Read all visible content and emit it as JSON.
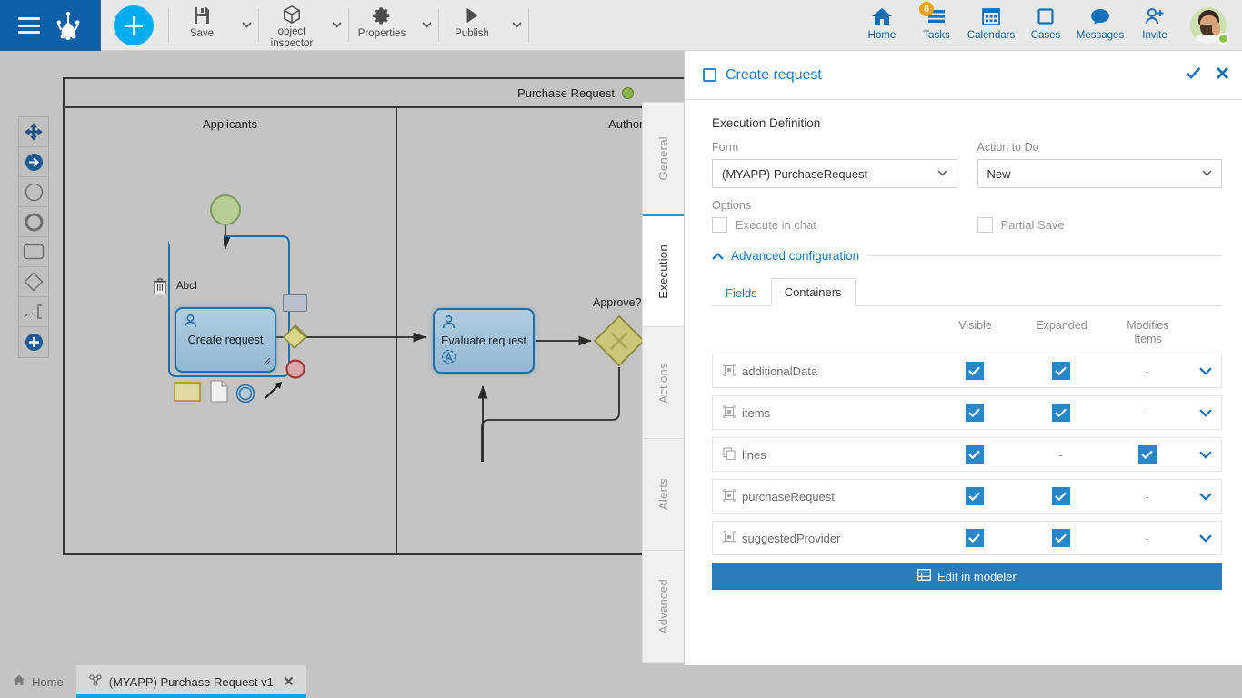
{
  "brand": {
    "logo_icon": "bizagi-frog-logo",
    "menu_icon": "hamburger-menu-icon"
  },
  "toolbar": {
    "new_icon": "plus-icon",
    "items": [
      {
        "label": "Save",
        "icon": "save-floppy-icon",
        "has_caret": true
      },
      {
        "label": "object inspector",
        "icon": "cube-icon",
        "has_caret": true
      },
      {
        "label": "Properties",
        "icon": "gear-icon",
        "has_caret": true
      },
      {
        "label": "Publish",
        "icon": "play-triangle-icon",
        "has_caret": true
      }
    ]
  },
  "topnav": [
    {
      "label": "Home",
      "icon": "home-icon",
      "badge": ""
    },
    {
      "label": "Tasks",
      "icon": "tasks-icon",
      "badge": "8"
    },
    {
      "label": "Calendars",
      "icon": "calendar-icon",
      "badge": ""
    },
    {
      "label": "Cases",
      "icon": "cases-square-icon",
      "badge": ""
    },
    {
      "label": "Messages",
      "icon": "chat-bubble-icon",
      "badge": ""
    },
    {
      "label": "Invite",
      "icon": "invite-person-plus-icon",
      "badge": ""
    }
  ],
  "avatar": {
    "name": "avatar",
    "status": "online"
  },
  "palette": [
    {
      "icon": "move-cross-icon",
      "name": "pan-tool"
    },
    {
      "icon": "sequence-flow-arrow-icon",
      "name": "sequence-flow-tool"
    },
    {
      "icon": "start-event-circle-icon",
      "name": "start-event-tool"
    },
    {
      "icon": "end-event-circle-icon",
      "name": "end-event-tool"
    },
    {
      "icon": "task-rounded-rect-icon",
      "name": "task-tool"
    },
    {
      "icon": "gateway-diamond-icon",
      "name": "gateway-tool"
    },
    {
      "icon": "artifact-group-icon",
      "name": "artifact-tool"
    },
    {
      "icon": "add-circle-icon",
      "name": "add-element-tool"
    }
  ],
  "diagram": {
    "pool_label": "Purchase Request",
    "lanes": [
      {
        "label": "Applicants"
      },
      {
        "label": "Authorizers"
      }
    ],
    "nodes": [
      {
        "id": "start",
        "type": "start-event",
        "label": ""
      },
      {
        "id": "create",
        "type": "user-task",
        "label": "Create request"
      },
      {
        "id": "evaluate",
        "type": "user-task",
        "label": "Evaluate request"
      },
      {
        "id": "approve",
        "type": "exclusive-gateway",
        "label": "Approve?"
      }
    ],
    "selection_toolbar": {
      "text_label": "Abc",
      "tools": [
        {
          "icon": "trash-icon",
          "name": "delete-element"
        },
        {
          "icon": "text-abc-icon",
          "name": "rename-element"
        },
        {
          "icon": "task-shape-icon",
          "name": "change-to-task"
        },
        {
          "icon": "gateway-shape-icon",
          "name": "change-to-gateway"
        },
        {
          "icon": "end-event-shape-icon",
          "name": "change-to-end-event"
        },
        {
          "icon": "note-icon",
          "name": "add-annotation"
        },
        {
          "icon": "document-icon",
          "name": "attach-document"
        },
        {
          "icon": "intermediate-event-icon",
          "name": "add-intermediate-event"
        },
        {
          "icon": "connector-arrow-icon",
          "name": "add-connector"
        }
      ]
    }
  },
  "vtabs": [
    {
      "label": "General",
      "active": false
    },
    {
      "label": "Execution",
      "active": true
    },
    {
      "label": "Actions",
      "active": false
    },
    {
      "label": "Alerts",
      "active": false
    },
    {
      "label": "Advanced",
      "active": false
    }
  ],
  "panel": {
    "title": "Create request",
    "checkbox_checked": false,
    "confirm_icon": "check-icon",
    "close_icon": "close-x-icon",
    "section_title": "Execution Definition",
    "form": {
      "label": "Form",
      "value": "(MYAPP) PurchaseRequest"
    },
    "action": {
      "label": "Action to Do",
      "value": "New"
    },
    "options_label": "Options",
    "options": [
      {
        "label": "Execute in chat",
        "checked": false
      },
      {
        "label": "Partial Save",
        "checked": false
      }
    ],
    "advanced_link": "Advanced configuration",
    "advanced_expanded": true,
    "tabs": [
      {
        "label": "Fields",
        "active": false
      },
      {
        "label": "Containers",
        "active": true
      }
    ],
    "table": {
      "columns": [
        "Visible",
        "Expanded",
        "Modifies Items"
      ],
      "col_modifies_line1": "Modifies",
      "col_modifies_line2": "Items",
      "rows": [
        {
          "name": "additionalData",
          "icon": "container-entity-icon",
          "visible": "checked",
          "expanded": "checked",
          "modifies": "-"
        },
        {
          "name": "items",
          "icon": "container-entity-icon",
          "visible": "checked",
          "expanded": "checked",
          "modifies": "-"
        },
        {
          "name": "lines",
          "icon": "collection-copy-icon",
          "visible": "checked",
          "expanded": "-",
          "modifies": "checked"
        },
        {
          "name": "purchaseRequest",
          "icon": "container-entity-icon",
          "visible": "checked",
          "expanded": "checked",
          "modifies": "-"
        },
        {
          "name": "suggestedProvider",
          "icon": "container-entity-icon",
          "visible": "checked",
          "expanded": "checked",
          "modifies": "-"
        }
      ]
    },
    "edit_button": {
      "label": "Edit in modeler",
      "icon": "modeler-grid-icon"
    }
  },
  "bottom_tabs": [
    {
      "label": "Home",
      "icon": "home-small-icon",
      "active": false,
      "closable": false
    },
    {
      "label": "(MYAPP) Purchase Request v1",
      "icon": "process-diagram-icon",
      "active": true,
      "closable": true,
      "close_icon": "close-x-icon"
    }
  ],
  "colors": {
    "brand_blue": "#0b60a8",
    "accent_cyan": "#00aeef",
    "link_blue": "#1b7bbd",
    "checkbox_blue": "#2b86c5",
    "badge_orange": "#f0a11e",
    "canvas_gray": "#c4c4c4",
    "task_blue": "#93b8d3",
    "start_green": "#b6ce96",
    "gateway_olive": "#c8c878",
    "status_green": "#8bc34a"
  }
}
